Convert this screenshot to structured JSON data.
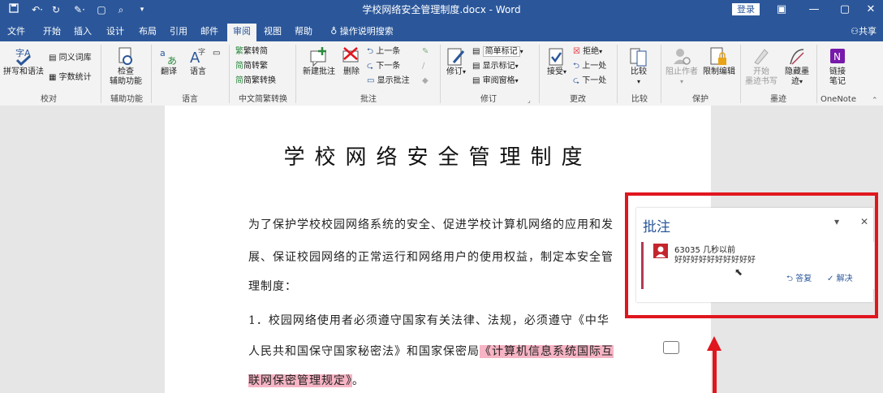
{
  "window": {
    "title": "学校网络安全管理制度.docx  -  Word",
    "login": "登录"
  },
  "menu": {
    "tabs": [
      "文件",
      "开始",
      "插入",
      "设计",
      "布局",
      "引用",
      "邮件",
      "审阅",
      "视图",
      "帮助"
    ],
    "active": "审阅",
    "tell_me": "操作说明搜索",
    "share": "共享"
  },
  "ribbon": {
    "proofing": {
      "spelling": "拼写和语法",
      "thesaurus": "同义词库",
      "word_count": "字数统计",
      "label": "校对"
    },
    "accessibility": {
      "check_line1": "检查",
      "check_line2": "辅助功能",
      "label": "辅助功能"
    },
    "language": {
      "translate": "翻译",
      "language": "语言",
      "label": "语言"
    },
    "chinese": {
      "to_simplified": "繁转简",
      "to_traditional": "简转繁",
      "convert": "简繁转换",
      "label": "中文简繁转换"
    },
    "comments": {
      "new": "新建批注",
      "delete": "删除",
      "prev": "上一条",
      "next": "下一条",
      "show": "显示批注",
      "label": "批注"
    },
    "tracking": {
      "track": "修订",
      "markup": "简单标记",
      "show_markup": "显示标记",
      "reviewing_pane": "审阅窗格",
      "label": "修订"
    },
    "changes": {
      "accept": "接受",
      "reject": "拒绝",
      "previous": "上一处",
      "next": "下一处",
      "label": "更改"
    },
    "compare": {
      "compare": "比较",
      "label": "比较"
    },
    "protect": {
      "block_authors": "阻止作者",
      "restrict": "限制编辑",
      "label": "保护"
    },
    "ink": {
      "start_line1": "开始",
      "start_line2": "墨迹书写",
      "hide_line1": "隐藏墨",
      "hide_line2": "迹",
      "label": "墨迹"
    },
    "onenote": {
      "link_line1": "链接",
      "link_line2": "笔记",
      "label": "OneNote"
    }
  },
  "document": {
    "heading": "学校网络安全管理制度",
    "lines": [
      "为了保护学校校园网络系统的安全、促进学校计算机网络的应用和发",
      "展、保证校园网络的正常运行和网络用户的使用权益，制定本安全管",
      "理制度：",
      "1．校园网络使用者必须遵守国家有关法律、法规，必须遵守《中华",
      "人民共和国保守国家秘密法》和国家保密局"
    ],
    "highlight_part1": "《计算机信息系统国际互",
    "highlight_part2": "联网保密管理规定》",
    "end_punct": "。"
  },
  "comment_pane": {
    "title": "批注",
    "author": "63035",
    "time": "几秒以前",
    "text": "好好好好好好好好好好",
    "reply": "答复",
    "resolve": "解决"
  },
  "colors": {
    "accent": "#2b579a",
    "highlight": "#f6b4c4",
    "annotation": "#e0161e"
  }
}
